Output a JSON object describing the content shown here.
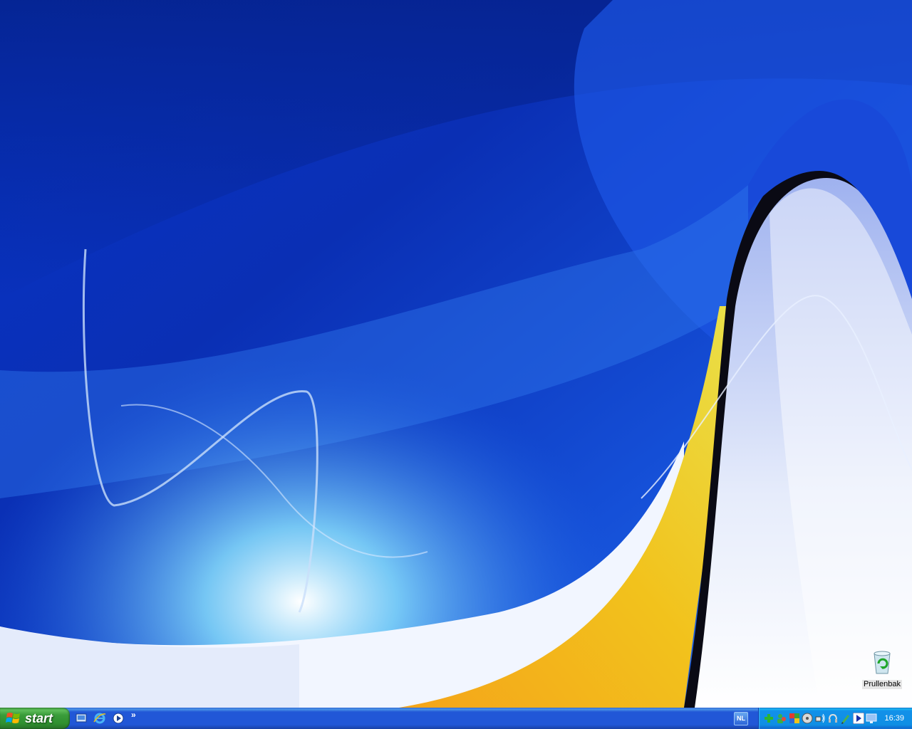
{
  "desktop": {
    "icons": [
      {
        "label": "Prullenbak",
        "icon": "recycle-bin-icon"
      }
    ]
  },
  "taskbar": {
    "start_label": "start",
    "quick_launch": [
      {
        "icon": "show-desktop-icon"
      },
      {
        "icon": "internet-explorer-icon"
      },
      {
        "icon": "media-player-icon"
      }
    ],
    "quick_launch_more": "»",
    "language": "NL",
    "tray_icons": [
      "network-plus-icon",
      "users-icon",
      "security-shield-icon",
      "disc-icon",
      "wireless-icon",
      "headset-icon",
      "pen-icon",
      "media-play-icon",
      "monitor-icon"
    ],
    "clock": "16:39"
  },
  "colors": {
    "taskbar_blue": "#2157d7",
    "start_green": "#3a9c3a",
    "tray_blue": "#0f8fe4",
    "wallpaper_blue": "#0a3bd0",
    "accent_yellow": "#f0c419"
  }
}
